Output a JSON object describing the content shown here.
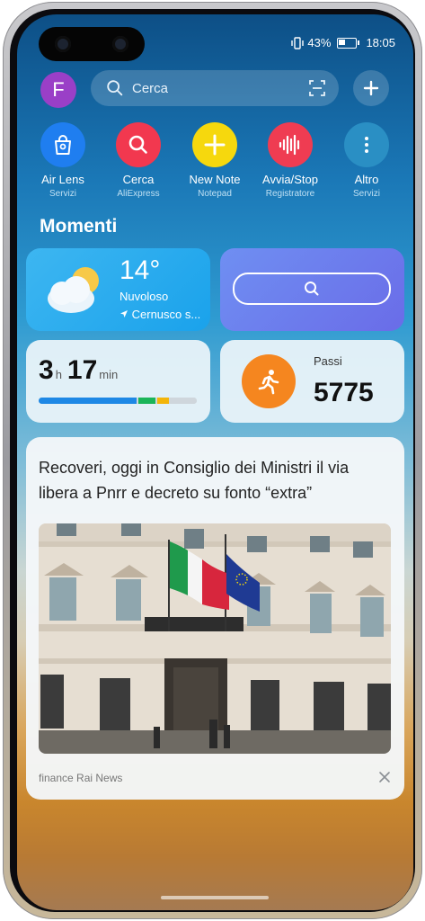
{
  "status": {
    "battery": "43%",
    "time": "18:05"
  },
  "top": {
    "avatar_letter": "F",
    "search_placeholder": "Cerca"
  },
  "apps": [
    {
      "label": "Air Lens",
      "sub": "Servizi",
      "color": "#1f7ef0",
      "icon": "bag-icon"
    },
    {
      "label": "Cerca",
      "sub": "AliExpress",
      "color": "#f2384f",
      "icon": "search-icon"
    },
    {
      "label": "New Note",
      "sub": "Notepad",
      "color": "#f6d80d",
      "icon": "plus-icon"
    },
    {
      "label": "Avvia/Stop",
      "sub": "Registratore",
      "color": "#ef3c52",
      "icon": "waveform-icon"
    },
    {
      "label": "Altro",
      "sub": "Servizi",
      "color": "#2a8fc4",
      "icon": "more-icon"
    }
  ],
  "section_title": "Momenti",
  "weather": {
    "temp": "14°",
    "condition": "Nuvoloso",
    "location": "Cernusco s..."
  },
  "screen_time": {
    "hours": "3",
    "hours_unit": "h",
    "minutes": "17",
    "minutes_unit": "min",
    "segments": [
      {
        "color": "#1e88e5",
        "fraction": 0.64
      },
      {
        "color": "#1bb559",
        "fraction": 0.11
      },
      {
        "color": "#f3b50a",
        "fraction": 0.08
      },
      {
        "color": "#cfd6dc",
        "fraction": 0.17
      }
    ]
  },
  "steps": {
    "label": "Passi",
    "value": "5775"
  },
  "news": {
    "headline": "Recoveri, oggi in Consiglio dei Ministri il via libera a Pnrr e decreto su fonto “extra”",
    "source": "finance  Rai News"
  }
}
